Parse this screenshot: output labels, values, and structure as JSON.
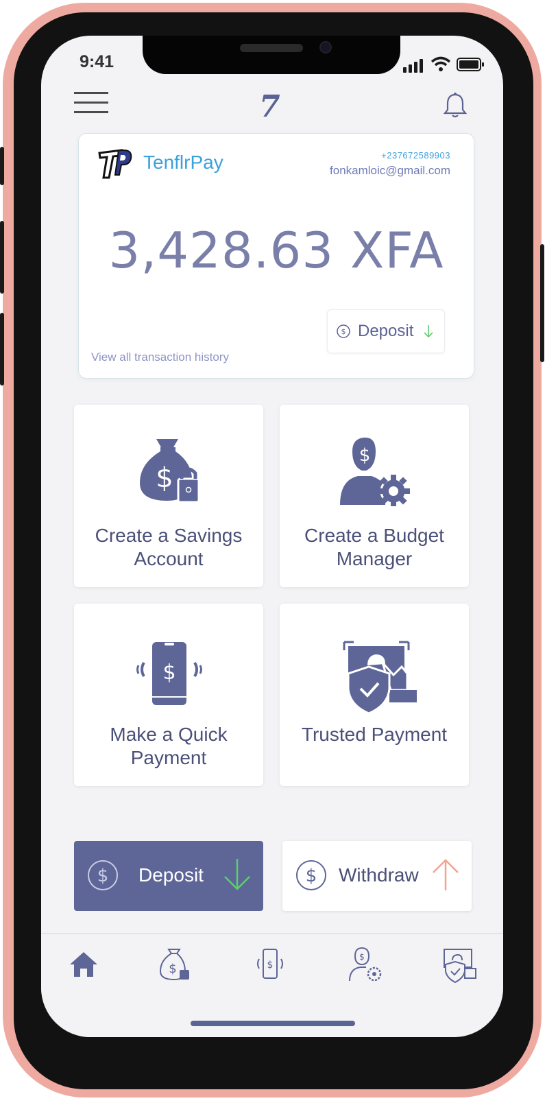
{
  "status_bar": {
    "time": "9:41"
  },
  "header": {
    "logo_glyph": "7",
    "menu_icon": "hamburger-menu-icon",
    "bell_icon": "bell-icon"
  },
  "card": {
    "brand_name": "TenflrPay",
    "phone": "+237672589903",
    "email": "fonkamloic@gmail.com",
    "balance": "3,428.63 XFA",
    "deposit_label": "Deposit",
    "history_link": "View all transaction history"
  },
  "tiles": [
    {
      "line1": "Create a Savings",
      "line2": "Account",
      "icon": "savings-bag-lock-icon"
    },
    {
      "line1": "Create a Budget",
      "line2": "Manager",
      "icon": "budget-manager-gear-icon"
    },
    {
      "line1": "Make a Quick",
      "line2": "Payment",
      "icon": "phone-payment-icon"
    },
    {
      "line1": "Trusted Payment",
      "line2": "",
      "icon": "trusted-shield-payment-icon"
    }
  ],
  "actions": {
    "deposit_label": "Deposit",
    "withdraw_label": "Withdraw"
  },
  "colors": {
    "primary": "#5e6698",
    "accent_blue": "#3ba1dc",
    "deposit_arrow": "#5ccf6b",
    "withdraw_arrow": "#f2a48f",
    "frame": "#eeaaa0"
  },
  "tabbar": [
    "home-icon",
    "savings-bag-icon",
    "quick-payment-icon",
    "budget-manager-icon",
    "trusted-payment-icon"
  ]
}
